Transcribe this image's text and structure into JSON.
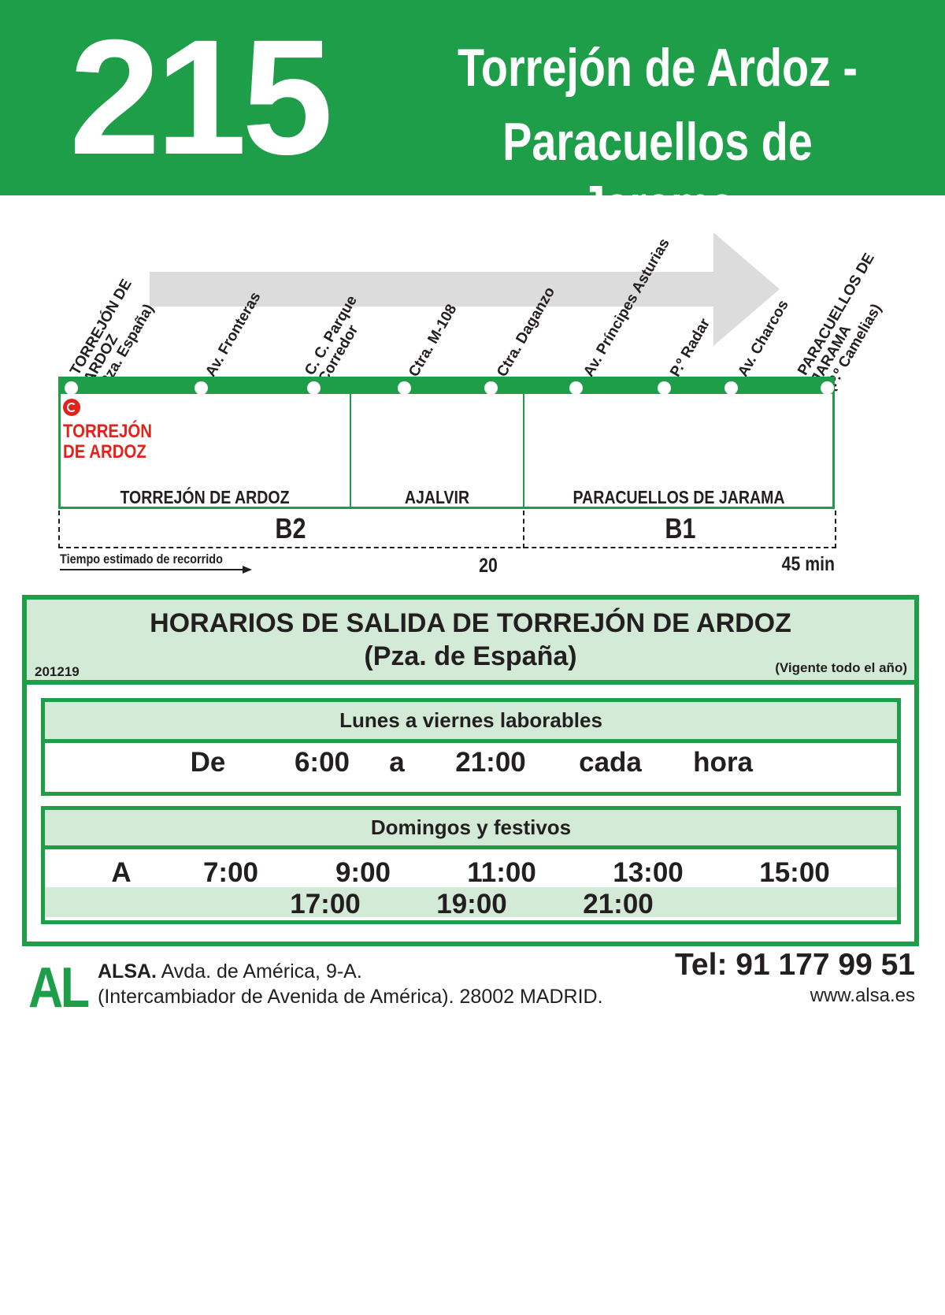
{
  "header": {
    "route_number": "215",
    "route_name_line1": "Torrejón de Ardoz -",
    "route_name_line2": "Paracuellos de Jarama"
  },
  "diagram": {
    "stops": [
      {
        "lines": [
          "TORREJÓN DE",
          "ARDOZ",
          "(Pza. España)"
        ]
      },
      {
        "lines": [
          "Av. Fronteras"
        ]
      },
      {
        "lines": [
          "C. C. Parque",
          "Corredor"
        ]
      },
      {
        "lines": [
          "Ctra. M-108"
        ]
      },
      {
        "lines": [
          "Ctra. Daganzo"
        ]
      },
      {
        "lines": [
          "Av. Príncipes Asturias"
        ]
      },
      {
        "lines": [
          "P.º Radar"
        ]
      },
      {
        "lines": [
          "Av. Charcos"
        ]
      },
      {
        "lines": [
          "PARACUELLOS DE",
          "JARAMA",
          "(P.º Camelias)"
        ]
      }
    ],
    "municipal_service": [
      "TORREJÓN",
      "DE ARDOZ"
    ],
    "zones": [
      "TORREJÓN DE ARDOZ",
      "AJALVIR",
      "PARACUELLOS DE JARAMA"
    ],
    "fare_zones": [
      "B2",
      "B1"
    ],
    "time_label": "Tiempo estimado de recorrido",
    "time_mid": "20",
    "time_end": "45 min"
  },
  "schedule": {
    "title_line1": "HORARIOS DE SALIDA DE TORREJÓN DE ARDOZ",
    "title_line2": "(Pza. de España)",
    "code": "201219",
    "validity": "(Vigente todo el año)",
    "weekdays": {
      "heading": "Lunes a viernes laborables",
      "row": [
        "De",
        "6:00",
        "a",
        "21:00",
        "cada",
        "hora"
      ]
    },
    "sundays": {
      "heading": "Domingos y festivos",
      "prefix": "A",
      "times_row1": [
        "7:00",
        "9:00",
        "11:00",
        "13:00",
        "15:00"
      ],
      "times_row2": [
        "17:00",
        "19:00",
        "21:00"
      ]
    }
  },
  "footer": {
    "logo": "AL",
    "company": "ALSA.",
    "address_line1": "Avda. de América, 9-A.",
    "address_line2": "(Intercambiador de Avenida de América). 28002 MADRID.",
    "phone": "Tel: 91 177 99 51",
    "web": "www.alsa.es"
  },
  "colors": {
    "brand_green": "#1f9e4a",
    "light_green": "#d3ead7",
    "municipal_red": "#e2231a"
  }
}
